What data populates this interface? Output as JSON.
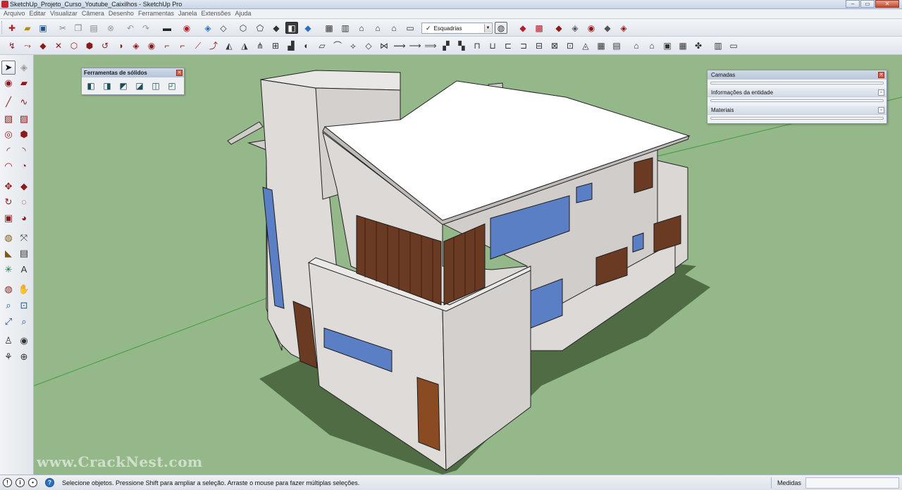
{
  "window": {
    "title": "SketchUp_Projeto_Curso_Youtube_Caixilhos - SketchUp Pro",
    "controls": {
      "minimize": "–",
      "maximize": "▭",
      "close": "✕"
    }
  },
  "menu": {
    "items": [
      "Arquivo",
      "Editar",
      "Visualizar",
      "Câmera",
      "Desenho",
      "Ferramentas",
      "Janela",
      "Extensões",
      "Ajuda"
    ]
  },
  "toolbar": {
    "row1_icons": [
      "new-file-icon",
      "open-folder-icon",
      "save-icon",
      "cut-icon",
      "copy-icon",
      "paste-icon",
      "erase-icon",
      "undo-icon",
      "redo-icon",
      "print-icon",
      "model-info-icon",
      "iso-view-icon",
      "top-view-icon",
      "front-view-icon",
      "right-view-icon",
      "back-view-icon",
      "left-view-icon",
      "xray-style-icon",
      "wireframe-style-icon",
      "hidden-line-style-icon",
      "shaded-style-icon",
      "textured-style-icon",
      "component-icon",
      "group-icon",
      "house-icon",
      "warehouse-icon",
      "share-model-icon",
      "get-models-icon",
      "scene-check-icon",
      "add-location-icon",
      "terrain-icon",
      "photo-texture-icon",
      "sandbox-icon",
      "ruby-icon",
      "sketch-icon",
      "layout-icon",
      "extension-icon"
    ],
    "scene_select": {
      "checked": "✓",
      "value": "Esquadrias"
    }
  },
  "solid_tools": {
    "title": "Ferramentas de sólidos",
    "close": "✕",
    "icons": [
      "outer-shell-icon",
      "intersect-icon",
      "union-icon",
      "subtract-icon",
      "trim-icon",
      "split-icon"
    ]
  },
  "tray": {
    "panels": [
      {
        "name": "layers",
        "label": "Camadas",
        "button": "✕"
      },
      {
        "name": "entity-info",
        "label": "Informações da entidade",
        "button": "▫"
      },
      {
        "name": "materials",
        "label": "Materiais",
        "button": "▫"
      }
    ]
  },
  "status": {
    "message": "Selecione objetos. Pressione Shift para ampliar a seleção. Arraste o mouse para fazer múltiplas seleções.",
    "measurements_label": "Medidas",
    "icons": {
      "geo": "!",
      "info": "i",
      "user": "•",
      "help": "?"
    }
  },
  "watermark": "www.CrackNest.com",
  "colors": {
    "ground": "#95b88a",
    "shadow": "#4f6c45",
    "wall": "#dedbd9",
    "roof": "#ffffff",
    "shutter": "#6a3b22",
    "glass": "#5b7fc4",
    "brand": "#c0282d"
  }
}
